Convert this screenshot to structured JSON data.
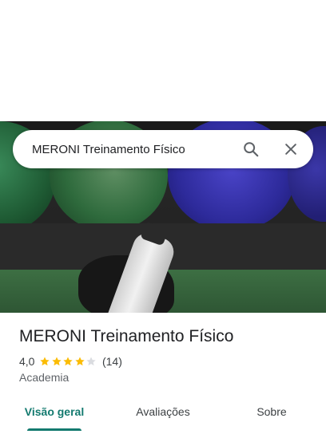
{
  "search": {
    "query": "MERONI Treinamento Físico"
  },
  "icons": {
    "search": "search-icon",
    "close": "close-icon",
    "star": "star-icon"
  },
  "place": {
    "name": "MERONI Treinamento Físico",
    "rating_text": "4,0",
    "rating_value": 4.0,
    "reviews_text": "(14)",
    "category": "Academia"
  },
  "tabs": [
    {
      "label": "Visão geral",
      "active": true
    },
    {
      "label": "Avaliações",
      "active": false
    },
    {
      "label": "Sobre",
      "active": false
    }
  ],
  "colors": {
    "accent": "#137a6f",
    "star": "#fbbc04",
    "star_empty": "#dadce0"
  }
}
